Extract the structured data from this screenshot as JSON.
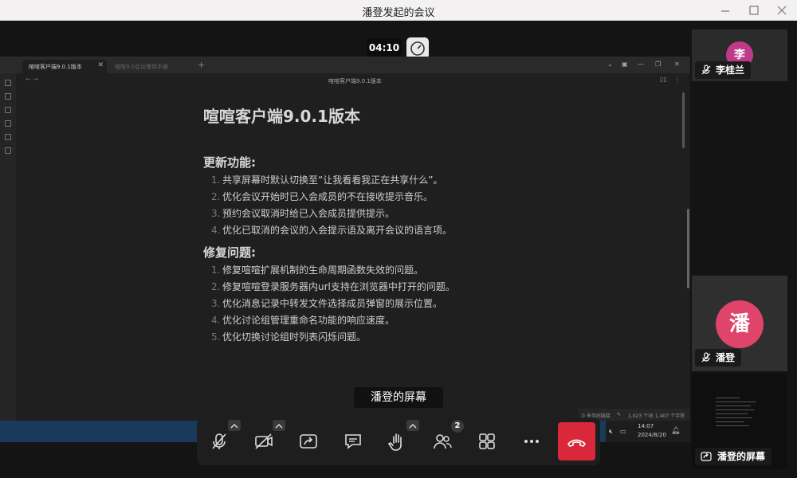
{
  "window": {
    "title": "潘登发起的会议"
  },
  "meeting": {
    "timer": "04:10",
    "sharer_label": "潘登的屏幕"
  },
  "shared_screen": {
    "tabs": [
      {
        "label": "喧喧客户端9.0.1版本"
      },
      {
        "label": "喧喧9.0会议使用手册"
      }
    ],
    "doc_path": "喧喧客户端9.0.1版本",
    "doc": {
      "title": "喧喧客户端9.0.1版本",
      "sections": [
        {
          "heading": "更新功能:",
          "items": [
            "共享屏幕时默认切换至“让我看看我正在共享什么”。",
            "优化会议开始时已入会成员的不在接收提示音乐。",
            "预约会议取消时给已入会成员提供提示。",
            "优化已取消的会议的入会提示语及离开会议的语言项。"
          ]
        },
        {
          "heading": "修复问题:",
          "items": [
            "修复喧喧扩展机制的生命周期函数失效的问题。",
            "修复喧喧登录服务器内url支持在浏览器中打开的问题。",
            "优化消息记录中转发文件选择成员弹窗的展示位置。",
            "优化讨论组管理重命名功能的响应速度。",
            "优化切换讨论组时列表闪烁问题。"
          ]
        }
      ]
    },
    "status": {
      "left": "0 多页间链接",
      "words": "1,023 个词",
      "chars": "1,407 个字符"
    },
    "taskbar": {
      "time": "14:07",
      "date": "2024/8/20"
    }
  },
  "controls": {
    "participants_count": "2",
    "icons": [
      "mic-off-icon",
      "camera-off-icon",
      "share-screen-icon",
      "chat-icon",
      "raise-hand-icon",
      "participants-icon",
      "layout-grid-icon",
      "more-icon",
      "hangup-icon"
    ],
    "hangup_color": "#d9283a"
  },
  "participants": [
    {
      "name": "李桂兰",
      "avatar_text": "李",
      "avatar_color": "#c03a8a"
    },
    {
      "name": "潘登",
      "avatar_text": "潘",
      "avatar_color": "#e0446a"
    },
    {
      "name": "潘登的屏幕"
    }
  ]
}
